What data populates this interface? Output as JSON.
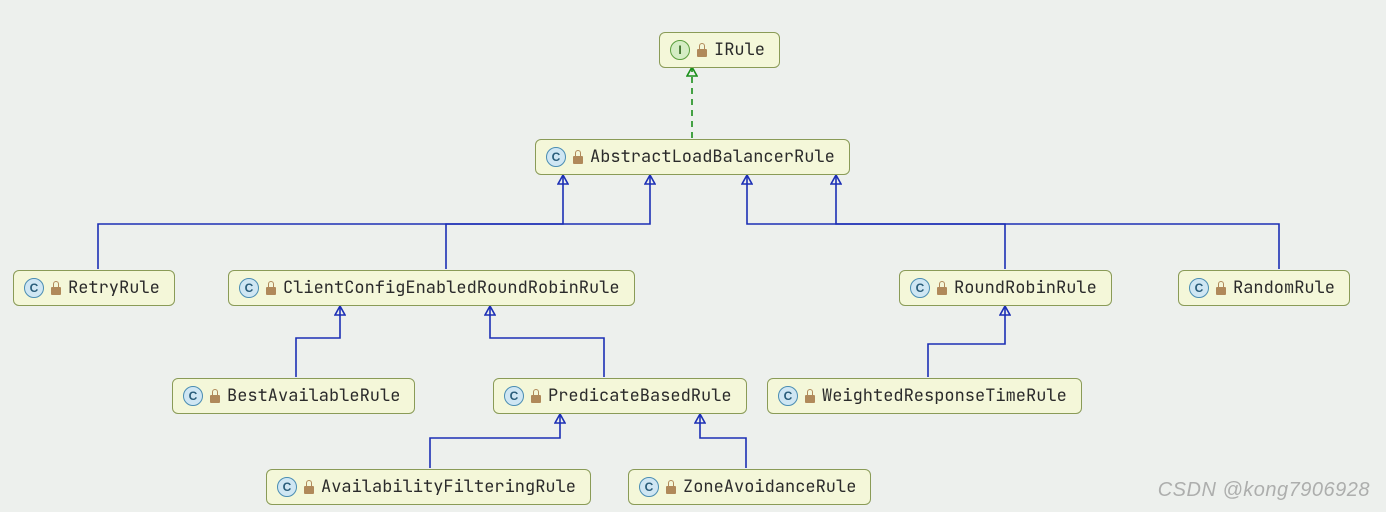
{
  "diagram": {
    "nodes": {
      "irule": {
        "type": "interface",
        "label": "IRule"
      },
      "abstract": {
        "type": "class",
        "label": "AbstractLoadBalancerRule"
      },
      "retry": {
        "type": "class",
        "label": "RetryRule"
      },
      "clientcfg": {
        "type": "class",
        "label": "ClientConfigEnabledRoundRobinRule"
      },
      "roundrobin": {
        "type": "class",
        "label": "RoundRobinRule"
      },
      "random": {
        "type": "class",
        "label": "RandomRule"
      },
      "bestavail": {
        "type": "class",
        "label": "BestAvailableRule"
      },
      "predicate": {
        "type": "class",
        "label": "PredicateBasedRule"
      },
      "weighted": {
        "type": "class",
        "label": "WeightedResponseTimeRule"
      },
      "availfilter": {
        "type": "class",
        "label": "AvailabilityFilteringRule"
      },
      "zoneavoid": {
        "type": "class",
        "label": "ZoneAvoidanceRule"
      }
    },
    "badge_interface_letter": "I",
    "badge_class_letter": "C",
    "relations": [
      {
        "from": "abstract",
        "to": "irule",
        "kind": "implements"
      },
      {
        "from": "retry",
        "to": "abstract",
        "kind": "extends"
      },
      {
        "from": "clientcfg",
        "to": "abstract",
        "kind": "extends"
      },
      {
        "from": "roundrobin",
        "to": "abstract",
        "kind": "extends"
      },
      {
        "from": "random",
        "to": "abstract",
        "kind": "extends"
      },
      {
        "from": "bestavail",
        "to": "clientcfg",
        "kind": "extends"
      },
      {
        "from": "predicate",
        "to": "clientcfg",
        "kind": "extends"
      },
      {
        "from": "weighted",
        "to": "roundrobin",
        "kind": "extends"
      },
      {
        "from": "availfilter",
        "to": "predicate",
        "kind": "extends"
      },
      {
        "from": "zoneavoid",
        "to": "predicate",
        "kind": "extends"
      }
    ]
  },
  "watermark": "CSDN @kong7906928"
}
